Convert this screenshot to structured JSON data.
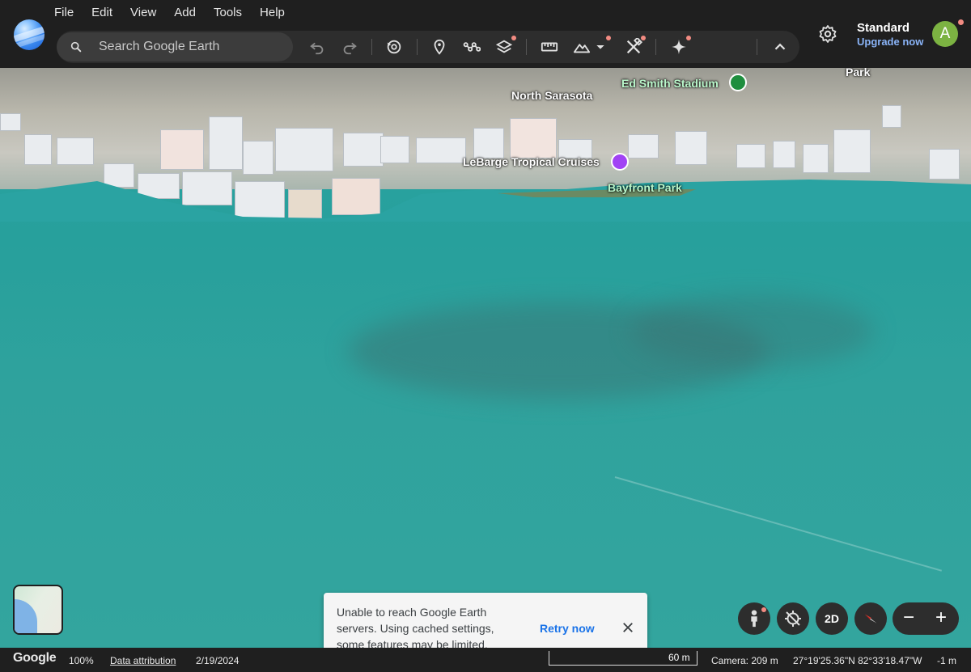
{
  "menu": [
    "File",
    "Edit",
    "View",
    "Add",
    "Tools",
    "Help"
  ],
  "search": {
    "placeholder": "Search Google Earth"
  },
  "account": {
    "plan": "Standard",
    "upgrade": "Upgrade now",
    "avatar_letter": "A"
  },
  "map_labels": {
    "north_sarasota": "North Sarasota",
    "ed_smith": "Ed Smith Stadium",
    "park": "Park",
    "lebarge": "LeBarge Tropical Cruises",
    "bayfront": "Bayfront Park"
  },
  "controls": {
    "two_d": "2D",
    "zoom_out": "−",
    "zoom_in": "+"
  },
  "toast": {
    "message": "Unable to reach Google Earth servers. Using cached settings, some features may be limited.",
    "retry": "Retry now"
  },
  "status": {
    "brand": "Google",
    "zoom": "100%",
    "attribution": "Data attribution",
    "date": "2/19/2024",
    "scale": "60 m",
    "camera": "Camera: 209 m",
    "coords": "27°19'25.36\"N 82°33'18.47\"W",
    "elevation": "-1 m"
  },
  "colors": {
    "accent_blue": "#8ab4f8",
    "link_blue": "#1a73e8",
    "notify_dot": "#f28b82",
    "avatar_bg": "#7cb342"
  }
}
